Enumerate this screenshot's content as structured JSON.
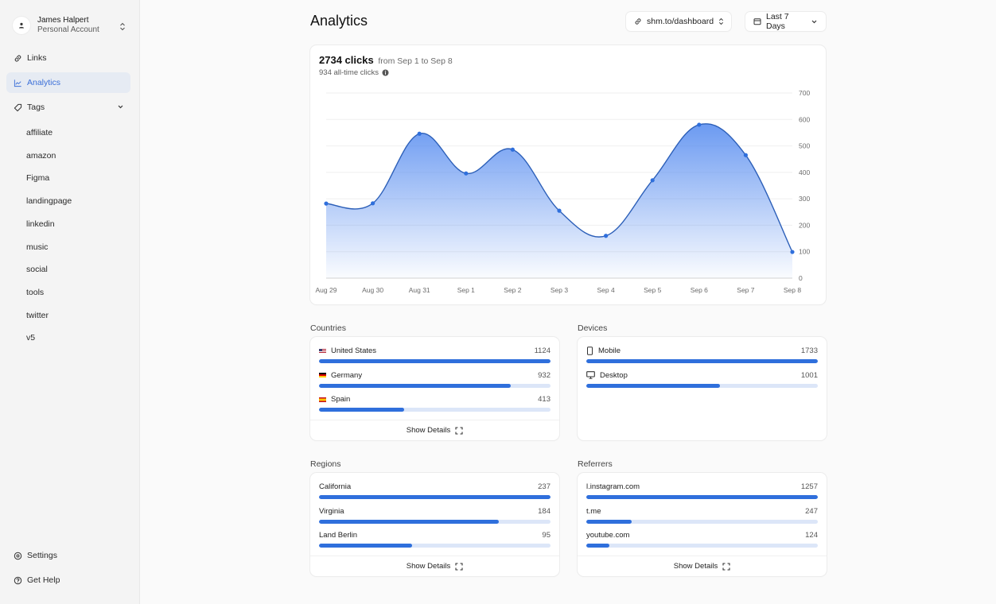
{
  "account": {
    "name": "James Halpert",
    "type": "Personal Account"
  },
  "sidebar": {
    "nav": [
      {
        "label": "Links",
        "icon": "link-icon"
      },
      {
        "label": "Analytics",
        "icon": "chart-icon",
        "active": true
      },
      {
        "label": "Tags",
        "icon": "tag-icon"
      }
    ],
    "tags": [
      "affiliate",
      "amazon",
      "Figma",
      "landingpage",
      "linkedin",
      "music",
      "social",
      "tools",
      "twitter",
      "v5"
    ],
    "bottom": [
      {
        "label": "Settings",
        "icon": "settings-icon"
      },
      {
        "label": "Get Help",
        "icon": "help-icon"
      }
    ]
  },
  "header": {
    "title": "Analytics",
    "link_selector": "shm.to/dashboard",
    "date_range": "Last 7 Days"
  },
  "summary": {
    "clicks": "2734 clicks",
    "range": "from Sep 1 to Sep 8",
    "all_time": "934 all-time clicks"
  },
  "colors": {
    "accent": "#2f6fdc",
    "line": "#2c5fb8",
    "track": "#dce6f8"
  },
  "chart_data": {
    "type": "area",
    "title": "",
    "xlabel": "",
    "ylabel": "",
    "x": [
      "Aug 29",
      "Aug 30",
      "Aug 31",
      "Sep 1",
      "Sep 2",
      "Sep 3",
      "Sep 4",
      "Sep 5",
      "Sep 6",
      "Sep 7",
      "Sep 8"
    ],
    "series": [
      {
        "name": "clicks",
        "values": [
          282,
          283,
          546,
          396,
          486,
          255,
          160,
          370,
          580,
          465,
          99
        ]
      }
    ],
    "ylim": [
      0,
      700
    ],
    "yticks": [
      0,
      100,
      200,
      300,
      400,
      500,
      600,
      700
    ],
    "y_axis_side": "right",
    "grid": true
  },
  "panels": {
    "countries": {
      "title": "Countries",
      "rows": [
        {
          "label": "United States",
          "value": 1124,
          "flag": "us"
        },
        {
          "label": "Germany",
          "value": 932,
          "flag": "de"
        },
        {
          "label": "Spain",
          "value": 413,
          "flag": "es"
        }
      ],
      "action": "Show Details"
    },
    "devices": {
      "title": "Devices",
      "rows": [
        {
          "label": "Mobile",
          "value": 1733,
          "icon": "mobile-icon"
        },
        {
          "label": "Desktop",
          "value": 1001,
          "icon": "desktop-icon"
        }
      ]
    },
    "regions": {
      "title": "Regions",
      "rows": [
        {
          "label": "California",
          "value": 237
        },
        {
          "label": "Virginia",
          "value": 184
        },
        {
          "label": "Land Berlin",
          "value": 95
        }
      ],
      "action": "Show Details"
    },
    "referrers": {
      "title": "Referrers",
      "rows": [
        {
          "label": "l.instagram.com",
          "value": 1257
        },
        {
          "label": "t.me",
          "value": 247
        },
        {
          "label": "youtube.com",
          "value": 124
        }
      ],
      "action": "Show Details"
    }
  }
}
